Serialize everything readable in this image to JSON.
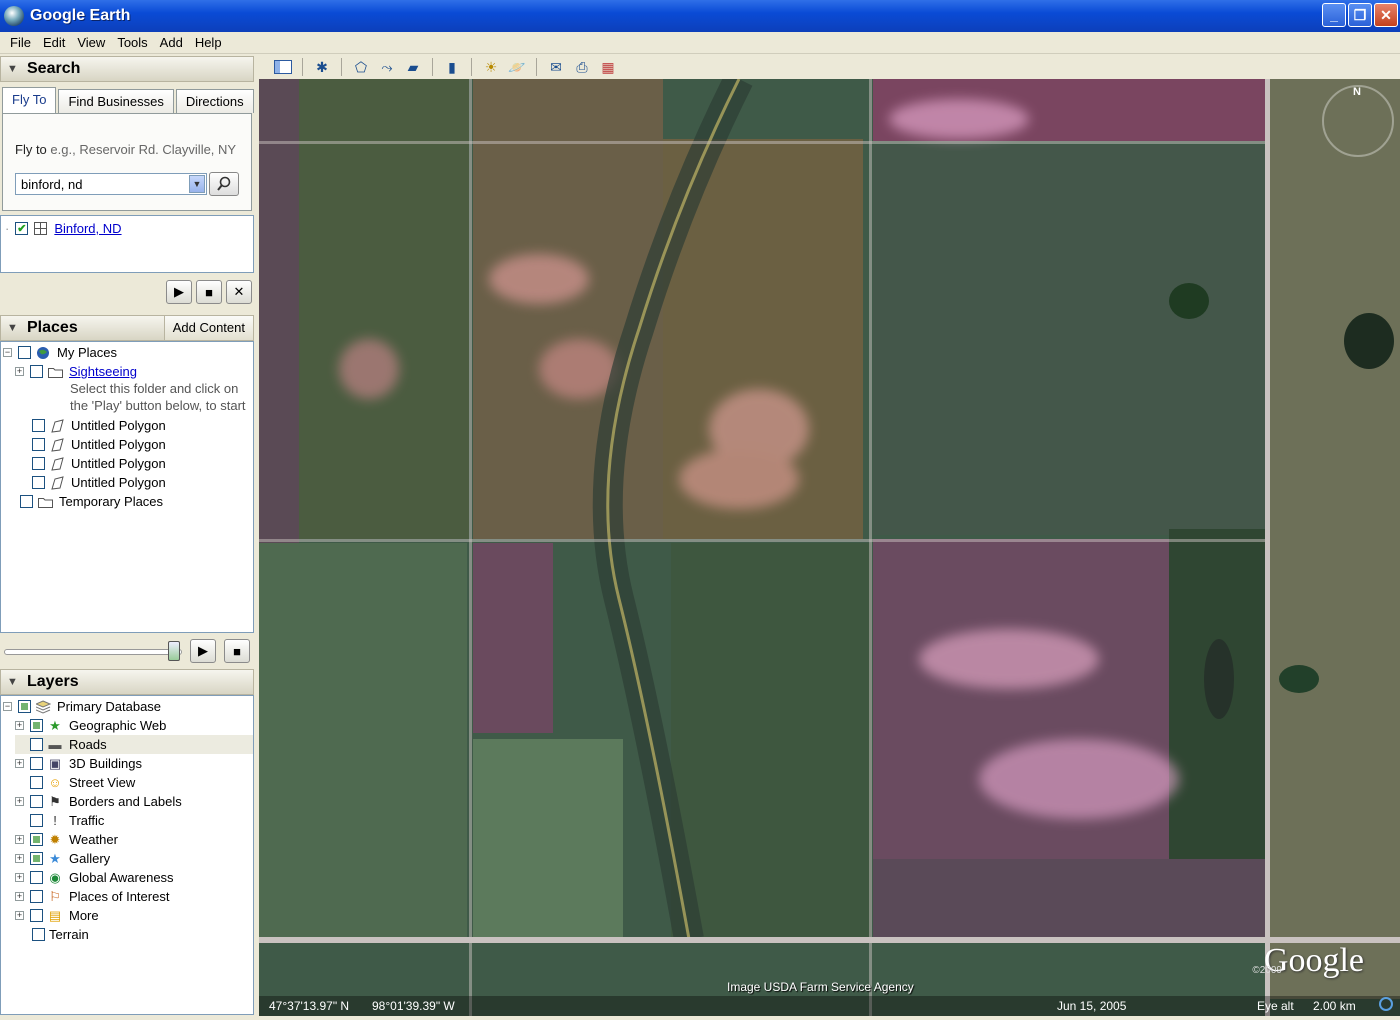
{
  "window": {
    "title": "Google Earth"
  },
  "menu": [
    "File",
    "Edit",
    "View",
    "Tools",
    "Add",
    "Help"
  ],
  "search": {
    "header": "Search",
    "tabs": [
      "Fly To",
      "Find Businesses",
      "Directions"
    ],
    "fly_label": "Fly to",
    "fly_example": "e.g., Reservoir Rd. Clayville, NY",
    "query": "binford, nd",
    "result": "Binford, ND"
  },
  "places": {
    "header": "Places",
    "add_content": "Add Content",
    "my_places": "My Places",
    "sightseeing": "Sightseeing",
    "sightseeing_desc1": "Select this folder and click on",
    "sightseeing_desc2": "the 'Play' button below, to start",
    "polygons": [
      "Untitled Polygon",
      "Untitled Polygon",
      "Untitled Polygon",
      "Untitled Polygon"
    ],
    "temporary": "Temporary Places"
  },
  "layers": {
    "header": "Layers",
    "primary": "Primary Database",
    "items": [
      {
        "label": "Geographic Web",
        "checked": "partial",
        "expand": true
      },
      {
        "label": "Roads",
        "checked": "none",
        "expand": false
      },
      {
        "label": "3D Buildings",
        "checked": "none",
        "expand": true
      },
      {
        "label": "Street View",
        "checked": "none",
        "expand": false
      },
      {
        "label": "Borders and Labels",
        "checked": "none",
        "expand": true
      },
      {
        "label": "Traffic",
        "checked": "none",
        "expand": false
      },
      {
        "label": "Weather",
        "checked": "partial",
        "expand": true
      },
      {
        "label": "Gallery",
        "checked": "partial",
        "expand": true
      },
      {
        "label": "Global Awareness",
        "checked": "none",
        "expand": true
      },
      {
        "label": "Places of Interest",
        "checked": "none",
        "expand": true
      },
      {
        "label": "More",
        "checked": "none",
        "expand": true
      }
    ],
    "terrain": "Terrain"
  },
  "map": {
    "lat": "47°37'13.97\" N",
    "lon": "98°01'39.39\" W",
    "credit": "Image USDA Farm Service Agency",
    "date": "Jun 15, 2005",
    "eye_alt_label": "Eye alt",
    "eye_alt": "2.00 km",
    "logo": "Google",
    "copyright": "©2009",
    "compass_n": "N"
  }
}
